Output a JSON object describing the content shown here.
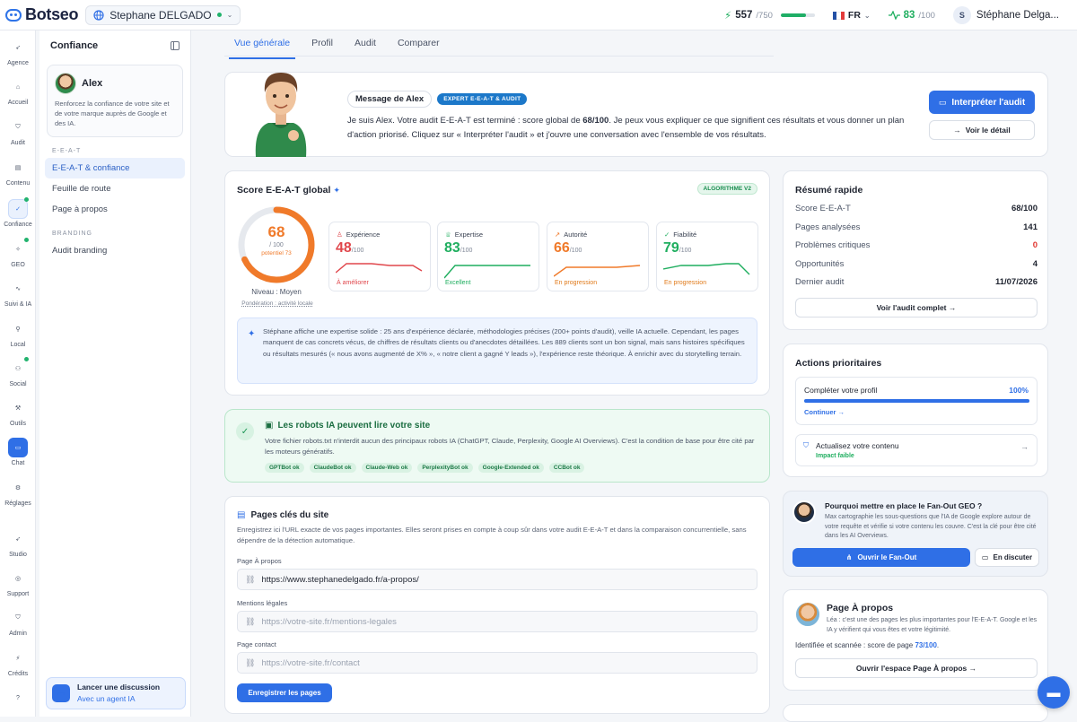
{
  "app": {
    "brand": "Botseo",
    "workspace": "Stephane DELGADO"
  },
  "topbar": {
    "credits_value": "557",
    "credits_max": "/750",
    "credits_fraction": 0.74,
    "lang": "FR",
    "score_value": "83",
    "score_max": "/100",
    "user_initial": "S",
    "user_name": "Stéphane Delga..."
  },
  "sidebar": {
    "items": [
      {
        "label": "Agence",
        "icon": "rocket-icon"
      },
      {
        "label": "Accueil",
        "icon": "home-icon"
      },
      {
        "label": "Audit",
        "icon": "shield-icon"
      },
      {
        "label": "Contenu",
        "icon": "document-icon"
      },
      {
        "label": "Confiance",
        "icon": "shield-check-icon"
      },
      {
        "label": "GEO",
        "icon": "sparkles-icon"
      },
      {
        "label": "Suivi & IA",
        "icon": "activity-icon"
      },
      {
        "label": "Local",
        "icon": "map-pin-icon"
      },
      {
        "label": "Social",
        "icon": "users-icon"
      },
      {
        "label": "Outils",
        "icon": "wand-icon"
      },
      {
        "label": "Chat",
        "icon": "chat-icon"
      },
      {
        "label": "Réglages",
        "icon": "gear-icon"
      },
      {
        "label": "Studio",
        "icon": "rocket-icon"
      },
      {
        "label": "Support",
        "icon": "lifebuoy-icon"
      },
      {
        "label": "Admin",
        "icon": "shield-icon"
      },
      {
        "label": "Crédits",
        "icon": "bolt-icon"
      },
      {
        "label": "?",
        "icon": "help-icon"
      }
    ]
  },
  "panel": {
    "title": "Confiance",
    "coach_name": "Alex",
    "coach_text": "Renforcez la confiance de votre site et de votre marque auprès de Google et des IA.",
    "section1": "E-E-A-T",
    "items1": [
      "E-E-A-T & confiance",
      "Feuille de route",
      "Page à propos"
    ],
    "section2": "BRANDING",
    "items2": [
      "Audit branding"
    ],
    "disc_title": "Lancer une discussion",
    "disc_sub": "Avec un agent IA"
  },
  "tabs": [
    "Vue générale",
    "Profil",
    "Audit",
    "Comparer"
  ],
  "hero": {
    "msg_label": "Message de Alex",
    "badge": "EXPERT E-E-A-T & AUDIT",
    "text_a": "Je suis Alex. Votre audit E-E-A-T est terminé : score global de ",
    "text_score": "68/100",
    "text_b": ". Je peux vous expliquer ce que signifient ces résultats et vous donner un plan d'action priorisé. Cliquez sur « Interpréter l'audit » et j'ouvre une conversation avec l'ensemble de vos résultats.",
    "btn_interpret": "Interpréter l'audit",
    "btn_detail": "Voir le détail"
  },
  "score": {
    "title": "Score E-E-A-T global",
    "algo": "ALGORITHME V2",
    "value": "68",
    "max": "/ 100",
    "fraction": 0.68,
    "potential": "potentiel 73",
    "niveau": "Niveau : Moyen",
    "ponderation": "Pondération : activité locale",
    "metrics": [
      {
        "label": "Expérience",
        "value": "48",
        "max": "/100",
        "status": "À améliorer",
        "color": "#e0474c"
      },
      {
        "label": "Expertise",
        "value": "83",
        "max": "/100",
        "status": "Excellent",
        "color": "#1fae5f"
      },
      {
        "label": "Autorité",
        "value": "66",
        "max": "/100",
        "status": "En progression",
        "color": "#f07a2a"
      },
      {
        "label": "Fiabilité",
        "value": "79",
        "max": "/100",
        "status": "En progression",
        "color": "#1fae5f"
      }
    ],
    "insight": "Stéphane affiche une expertise solide : 25 ans d'expérience déclarée, méthodologies précises (200+ points d'audit), veille IA actuelle. Cependant, les pages manquent de cas concrets vécus, de chiffres de résultats clients ou d'anecdotes détaillées. Les 889 clients sont un bon signal, mais sans histoires spécifiques ou résultats mesurés (« nous avons augmenté de X% », « notre client a gagné Y leads »), l'expérience reste théorique. À enrichir avec du storytelling terrain."
  },
  "robots": {
    "title": "Les robots IA peuvent lire votre site",
    "text": "Votre fichier robots.txt n'interdit aucun des principaux robots IA (ChatGPT, Claude, Perplexity, Google AI Overviews). C'est la condition de base pour être cité par les moteurs génératifs.",
    "tags": [
      "GPTBot ok",
      "ClaudeBot ok",
      "Claude-Web ok",
      "PerplexityBot ok",
      "Google-Extended ok",
      "CCBot ok"
    ]
  },
  "pages": {
    "title": "Pages clés du site",
    "desc": "Enregistrez ici l'URL exacte de vos pages importantes. Elles seront prises en compte à coup sûr dans votre audit E-E-A-T et dans la comparaison concurrentielle, sans dépendre de la détection automatique.",
    "fields": [
      {
        "label": "Page À propos",
        "value": "https://www.stephanedelgado.fr/a-propos/",
        "placeholder": ""
      },
      {
        "label": "Mentions légales",
        "value": "",
        "placeholder": "https://votre-site.fr/mentions-legales"
      },
      {
        "label": "Page contact",
        "value": "",
        "placeholder": "https://votre-site.fr/contact"
      }
    ],
    "save": "Enregistrer les pages"
  },
  "resume": {
    "title": "Résumé rapide",
    "rows": [
      {
        "k": "Score E-E-A-T",
        "v": "68/100"
      },
      {
        "k": "Pages analysées",
        "v": "141"
      },
      {
        "k": "Problèmes critiques",
        "v": "0"
      },
      {
        "k": "Opportunités",
        "v": "4"
      },
      {
        "k": "Dernier audit",
        "v": "11/07/2026"
      }
    ],
    "btn": "Voir l'audit complet →"
  },
  "actions": {
    "title": "Actions prioritaires",
    "a1_title": "Compléter votre profil",
    "a1_pct": "100%",
    "a1_fraction": 1,
    "a1_link": "Continuer →",
    "a2_title": "Actualisez votre contenu",
    "a2_sub": "Impact faible"
  },
  "fanout": {
    "title": "Pourquoi mettre en place le Fan-Out GEO ?",
    "text": "Max cartographie les sous-questions que l'IA de Google explore autour de votre requête et vérifie si votre contenu les couvre. C'est la clé pour être cité dans les AI Overviews.",
    "btn_open": "Ouvrir le Fan-Out",
    "btn_discuss": "En discuter"
  },
  "apropos": {
    "title": "Page À propos",
    "text": "Léa : c'est une des pages les plus importantes pour l'E-E-A-T. Google et les IA y vérifient qui vous êtes et votre légitimité.",
    "status_a": "Identifiée et scannée : score de page ",
    "status_score": "73/100",
    "status_end": ".",
    "btn": "Ouvrir l'espace Page À propos →"
  },
  "colors": {
    "primary": "#2f6fe6",
    "orange": "#f07a2a",
    "green": "#1fae5f",
    "red": "#e0474c"
  }
}
